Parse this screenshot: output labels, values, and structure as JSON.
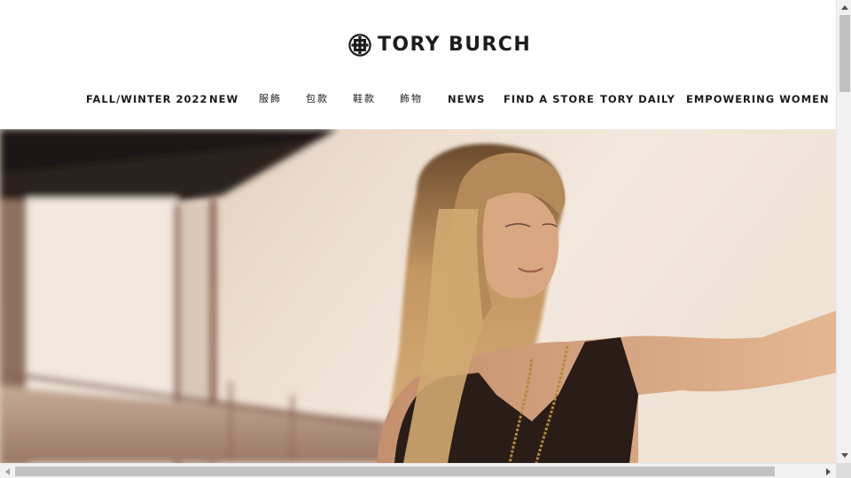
{
  "brand": {
    "name": "TORY BURCH",
    "logo_icon": "tory-burch-monogram-icon",
    "color": "#1d1d1d"
  },
  "nav": {
    "items": [
      {
        "label": "FALL/WINTER 2022"
      },
      {
        "label": "NEW"
      },
      {
        "label": "服飾"
      },
      {
        "label": "包款"
      },
      {
        "label": "鞋款"
      },
      {
        "label": "飾物"
      },
      {
        "label": "NEWS"
      },
      {
        "label": "FIND A STORE"
      },
      {
        "label": "TORY DAILY"
      },
      {
        "label": "EMPOWERING WOMEN"
      }
    ]
  },
  "hero": {
    "image_icon": "campaign-photo"
  },
  "scrollbars": {
    "up_icon": "scroll-up-arrow-icon",
    "down_icon": "scroll-down-arrow-icon",
    "left_icon": "scroll-left-arrow-icon",
    "right_icon": "scroll-right-arrow-icon"
  }
}
